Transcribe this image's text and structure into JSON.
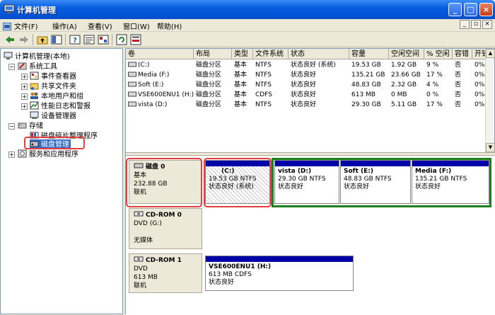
{
  "window": {
    "title": "计算机管理"
  },
  "menu": [
    "文件(F)",
    "操作(A)",
    "查看(V)",
    "窗口(W)",
    "帮助(H)"
  ],
  "tree": [
    {
      "label": "计算机管理(本地)",
      "indent": 0,
      "icon": "computer-icon"
    },
    {
      "label": "系统工具",
      "indent": 1,
      "icon": "tools-icon"
    },
    {
      "label": "事件查看器",
      "indent": 2,
      "icon": "event-viewer-icon"
    },
    {
      "label": "共享文件夹",
      "indent": 2,
      "icon": "shared-folder-icon"
    },
    {
      "label": "本地用户和组",
      "indent": 2,
      "icon": "users-icon"
    },
    {
      "label": "性能日志和警报",
      "indent": 2,
      "icon": "performance-icon"
    },
    {
      "label": "设备管理器",
      "indent": 2,
      "icon": "device-manager-icon"
    },
    {
      "label": "存储",
      "indent": 1,
      "icon": "storage-icon"
    },
    {
      "label": "磁盘碎片整理程序",
      "indent": 2,
      "icon": "defrag-icon"
    },
    {
      "label": "磁盘管理",
      "indent": 2,
      "icon": "disk-management-icon",
      "selected": true
    },
    {
      "label": "服务和应用程序",
      "indent": 1,
      "icon": "services-icon"
    }
  ],
  "volume_table": {
    "headers": [
      "卷",
      "布局",
      "类型",
      "文件系统",
      "状态",
      "容量",
      "空闲空间",
      "% 空闲",
      "容错",
      "开销"
    ],
    "rows": [
      [
        "(C:)",
        "磁盘分区",
        "基本",
        "NTFS",
        "状态良好 (系统)",
        "19.53 GB",
        "1.92 GB",
        "9 %",
        "否",
        "0%"
      ],
      [
        "Media (F:)",
        "磁盘分区",
        "基本",
        "NTFS",
        "状态良好",
        "135.21 GB",
        "23.66 GB",
        "17 %",
        "否",
        "0%"
      ],
      [
        "Soft (E:)",
        "磁盘分区",
        "基本",
        "NTFS",
        "状态良好",
        "48.83 GB",
        "2.32 GB",
        "4 %",
        "否",
        "0%"
      ],
      [
        "VSE600ENU1 (H:)",
        "磁盘分区",
        "基本",
        "CDFS",
        "状态良好",
        "613 MB",
        "0 MB",
        "0 %",
        "否",
        "0%"
      ],
      [
        "vista (D:)",
        "磁盘分区",
        "基本",
        "NTFS",
        "状态良好",
        "29.30 GB",
        "5.11 GB",
        "17 %",
        "否",
        "0%"
      ]
    ]
  },
  "disks": [
    {
      "name": "磁盘 0",
      "type": "基本",
      "size": "232.88 GB",
      "status": "联机",
      "partitions": [
        {
          "name": "(C:)",
          "info": "19.53 GB NTFS",
          "status": "状态良好 (系统)"
        },
        {
          "name": "vista  (D:)",
          "info": "29.30 GB NTFS",
          "status": "状态良好"
        },
        {
          "name": "Soft  (E:)",
          "info": "48.83 GB NTFS",
          "status": "状态良好"
        },
        {
          "name": "Media  (F:)",
          "info": "135.21 GB NTFS",
          "status": "状态良好"
        }
      ]
    },
    {
      "name": "CD-ROM 0",
      "type": "DVD (G:)",
      "status": "无媒体"
    },
    {
      "name": "CD-ROM 1",
      "type": "DVD",
      "size": "613 MB",
      "status": "联机",
      "partitions": [
        {
          "name": "VSE600ENU1  (H:)",
          "info": "613 MB CDFS",
          "status": "状态良好"
        }
      ]
    }
  ]
}
